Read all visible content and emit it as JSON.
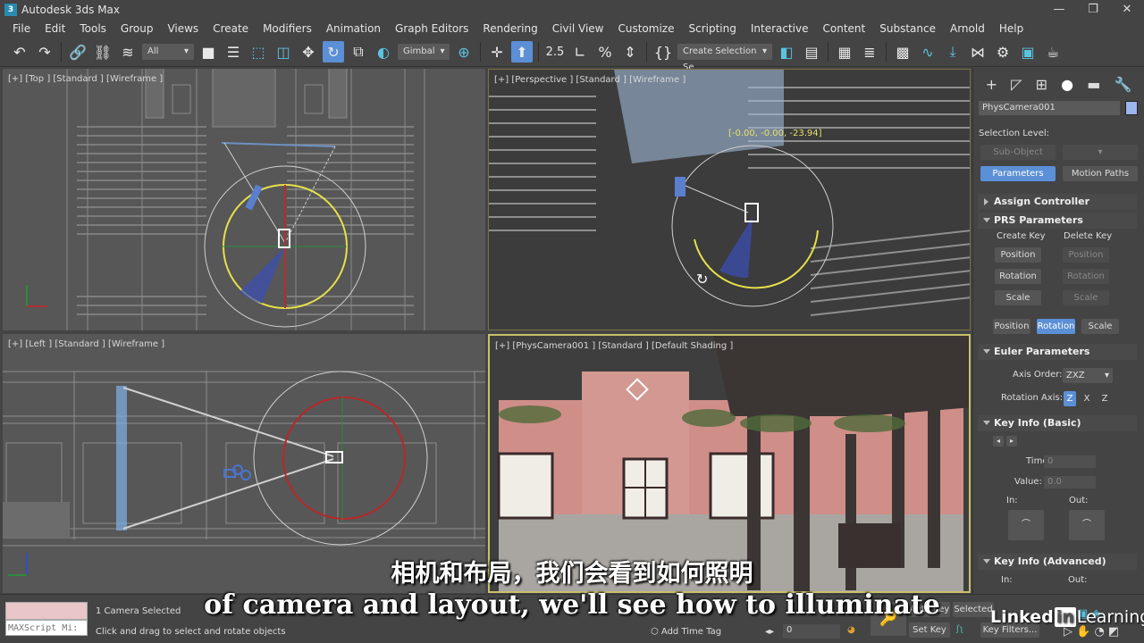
{
  "window": {
    "title": "Autodesk 3ds Max",
    "app_icon": "3",
    "minimize": "—",
    "restore": "❐",
    "close": "✕"
  },
  "menu": [
    "File",
    "Edit",
    "Tools",
    "Group",
    "Views",
    "Create",
    "Modifiers",
    "Animation",
    "Graph Editors",
    "Rendering",
    "Civil View",
    "Customize",
    "Scripting",
    "Interactive",
    "Content",
    "Substance",
    "Arnold",
    "Help"
  ],
  "toolbar": {
    "selection_filter": "All",
    "reference_coord": "Gimbal",
    "named_selection": "Create Selection Se",
    "snap_label": "2.5"
  },
  "viewports": {
    "top": {
      "label": "[+] [Top ] [Standard ] [Wireframe ]"
    },
    "perspective": {
      "label": "[+] [Perspective ] [Standard ] [Wireframe ]",
      "rotation_readout": "[-0.00, -0.00, -23.94]"
    },
    "left": {
      "label": "[+] [Left ] [Standard ] [Wireframe ]"
    },
    "camera": {
      "label": "[+] [PhysCamera001 ] [Standard ] [Default Shading ]"
    }
  },
  "command_panel": {
    "object_name": "PhysCamera001",
    "object_color": "#9db5ee",
    "selection_level_label": "Selection Level:",
    "sub_object": "Sub-Object",
    "parameters": "Parameters",
    "motion_paths": "Motion Paths",
    "assign_controller": "Assign Controller",
    "prs_parameters": "PRS Parameters",
    "create_key": "Create Key",
    "delete_key": "Delete Key",
    "create_position": "Position",
    "create_rotation": "Rotation",
    "create_scale": "Scale",
    "delete_position": "Position",
    "delete_rotation": "Rotation",
    "delete_scale": "Scale",
    "mode_position": "Position",
    "mode_rotation": "Rotation",
    "mode_scale": "Scale",
    "euler_parameters": "Euler Parameters",
    "axis_order_label": "Axis Order:",
    "axis_order_value": "ZXZ",
    "rotation_axis_label": "Rotation Axis:",
    "rotation_axis": [
      "Z",
      "X",
      "Z"
    ],
    "key_info_basic": "Key Info (Basic)",
    "time_label": "Time:",
    "time_value": "0",
    "value_label": "Value:",
    "value_value": "0.0",
    "in_label": "In:",
    "out_label": "Out:",
    "key_info_advanced": "Key Info (Advanced)",
    "adv_in_label": "In:",
    "adv_out_label": "Out:"
  },
  "status": {
    "maxscript_placeholder": "MAXScript Mi:",
    "selection_count": "1 Camera Selected",
    "prompt": "Click and drag to select and rotate objects",
    "add_time_tag": "Add Time Tag",
    "frame_value": "0",
    "auto_key": "Auto Key",
    "selected": "Selected",
    "set_key": "Set Key",
    "key_filters": "Key Filters..."
  },
  "subtitles": {
    "chinese": "相机和布局，我们会看到如何照明",
    "english": "of camera and layout, we'll see how to illuminate"
  },
  "branding": {
    "linkedin_a": "Linked",
    "linkedin_b": "in",
    "linkedin_c": "Learning"
  }
}
